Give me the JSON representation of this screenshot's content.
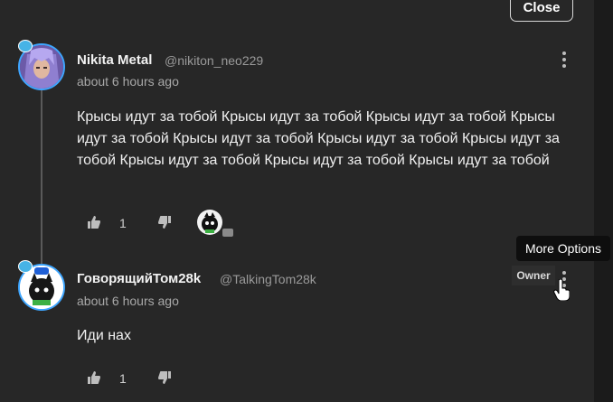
{
  "close_label": "Close",
  "tooltip": "More Options",
  "comments": [
    {
      "name": "Nikita Metal",
      "handle": "@nikiton_neo229",
      "time": "about 6 hours ago",
      "text": "Крысы идут за тобой Крысы идут за тобой Крысы идут за тобой Крысы идут за тобой Крысы идут за тобой Крысы идут за тобой Крысы идут за тобой Крысы идут за тобой Крысы идут за тобой Крысы идут за тобой",
      "likes": "1"
    },
    {
      "name": "ГоворящийТом28k",
      "handle": "@TalkingTom28k",
      "time": "about 6 hours ago",
      "text": "Иди нах",
      "likes": "1",
      "badge": "Owner"
    }
  ],
  "icons": {
    "more": "vertical-ellipsis-icon",
    "like": "thumbs-up-icon",
    "dislike": "thumbs-down-icon",
    "cursor": "hand-pointer-icon"
  },
  "colors": {
    "background": "#272727",
    "avatar_ring": "#3ea6ff"
  }
}
